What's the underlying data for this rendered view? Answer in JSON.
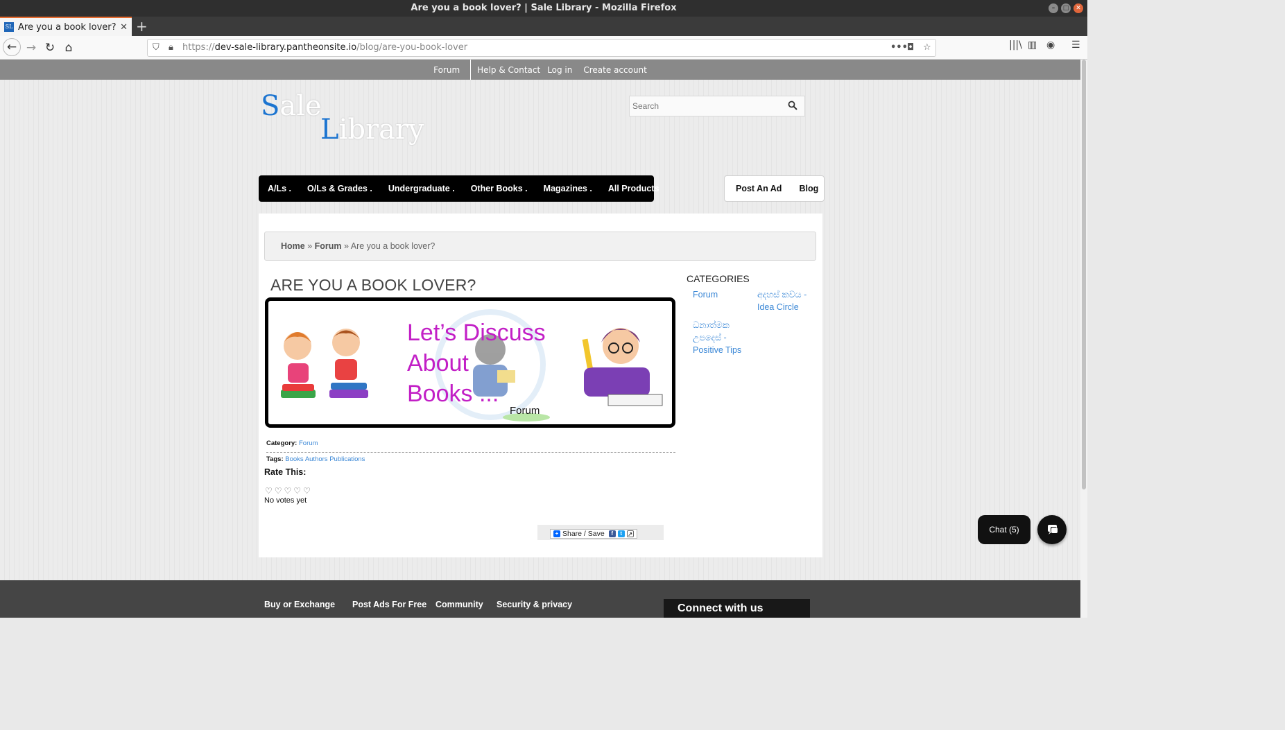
{
  "window": {
    "title": "Are you a book lover? | Sale Library - Mozilla Firefox",
    "controls": [
      "minimize",
      "maximize",
      "close"
    ]
  },
  "tab": {
    "favicon_text": "SL",
    "title": "Are you a book lover? | Sal",
    "close": "✕",
    "new_tab": "+"
  },
  "urlbar": {
    "scheme": "https://",
    "host": "dev-sale-library.pantheonsite.io",
    "path": "/blog/are-you-book-lover"
  },
  "topbar": {
    "forum": "Forum",
    "help": "Help & Contact",
    "login": "Log in",
    "create": "Create account"
  },
  "logo": {
    "s_cap": "S",
    "s_rest": "ale",
    "l_cap": "L",
    "l_rest": "ibrary",
    "accent_color": "#1b74d0"
  },
  "search": {
    "placeholder": "Search"
  },
  "main_menu": [
    "A/Ls .",
    "O/Ls & Grades .",
    "Undergraduate .",
    "Other Books .",
    "Magazines .",
    "All Products"
  ],
  "side_menu": [
    "Post An Ad",
    "Blog"
  ],
  "breadcrumb": {
    "home": "Home",
    "sep1": " » ",
    "forum": "Forum",
    "sep2": " » ",
    "current": "Are you a book lover?"
  },
  "article": {
    "title": "ARE YOU A BOOK LOVER?",
    "banner_text": [
      "Let’s Discuss",
      "About",
      "Books ..."
    ],
    "banner_label": "Forum",
    "category_label": "Category:",
    "category_value": "Forum",
    "tags_label": "Tags:",
    "tags": [
      "Books",
      "Authors",
      "Publications"
    ],
    "rate_label": "Rate This:",
    "rating": {
      "value": 0,
      "max": 5
    },
    "votes_text": "No votes yet",
    "share_label": "Share / Save"
  },
  "sidebar": {
    "title": "CATEGORIES",
    "categories": [
      "Forum",
      "අදහස් කවය - Idea Circle",
      "ධනාත්මක උපදෙස් - Positive Tips"
    ]
  },
  "footer": {
    "links": [
      "Buy or Exchange",
      "Post Ads For Free",
      "Community",
      "Security & privacy"
    ],
    "connect": "Connect with us"
  },
  "chat": {
    "label": "Chat (5)"
  }
}
